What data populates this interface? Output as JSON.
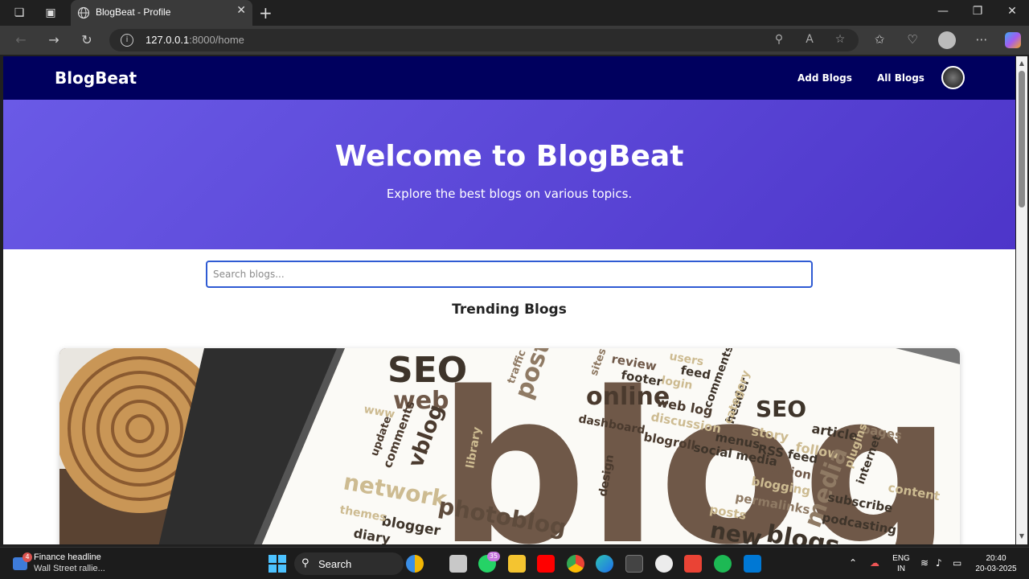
{
  "browser": {
    "tab_title": "BlogBeat - Profile",
    "url_host": "127.0.0.1",
    "url_path": ":8000/home"
  },
  "site": {
    "brand": "BlogBeat",
    "nav": [
      "Add Blogs",
      "All Blogs"
    ],
    "hero_title": "Welcome to BlogBeat",
    "hero_subtitle": "Explore the best blogs on various topics.",
    "search_placeholder": "Search blogs...",
    "section_title": "Trending Blogs",
    "colors": {
      "navbar": "#00005e",
      "hero_start": "#6a5ae6",
      "hero_end": "#4d35c9",
      "search_border": "#2f5bd3"
    }
  },
  "card_image": {
    "big_word": "blog",
    "words": [
      "SEO",
      "web",
      "vblog",
      "update",
      "comments",
      "network",
      "blogger",
      "diary",
      "photoblog",
      "post",
      "traffic",
      "online",
      "dashboard",
      "web log",
      "blogroll",
      "review",
      "footer",
      "users",
      "feed",
      "login",
      "comments",
      "header",
      "SEO",
      "article",
      "pages",
      "story",
      "menus",
      "RSS feed",
      "social media",
      "opinion",
      "follow",
      "plugins",
      "internet",
      "design",
      "library",
      "media",
      "subscribe",
      "permalinks",
      "blogging",
      "posts",
      "podcasting",
      "new",
      "blogs",
      "content",
      "themes",
      "discussion",
      "category",
      "www",
      "sites"
    ]
  },
  "taskbar": {
    "news_badge": "4",
    "news_title": "Finance headline",
    "news_sub": "Wall Street rallie...",
    "search_label": "Search",
    "whatsapp_badge": "35",
    "lang_1": "ENG",
    "lang_2": "IN",
    "time": "20:40",
    "date": "20-03-2025"
  }
}
